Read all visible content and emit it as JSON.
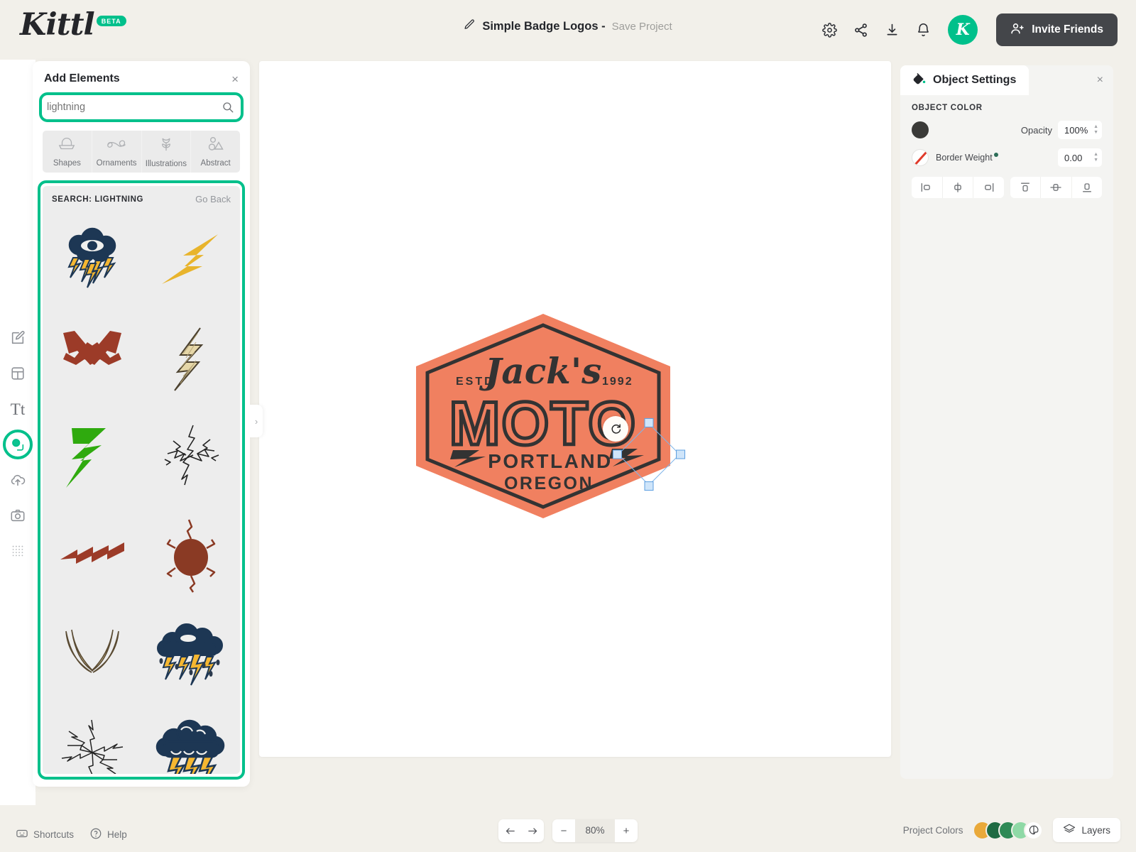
{
  "app": {
    "brand": "Kittl",
    "brand_badge": "BETA",
    "project_name": "Simple Badge Logos -",
    "save_project_label": "Save Project",
    "accent_color": "#00c08b",
    "avatar_initial": "K"
  },
  "header": {
    "icons": [
      {
        "name": "settings-gear-icon"
      },
      {
        "name": "share-icon"
      },
      {
        "name": "download-icon"
      },
      {
        "name": "notifications-bell-icon"
      }
    ],
    "invite_label": "Invite Friends"
  },
  "left_rail": {
    "items": [
      {
        "name": "design-edit-tool",
        "label": "Design"
      },
      {
        "name": "templates-tool",
        "label": "Templates"
      },
      {
        "name": "text-tool",
        "label": "Tt"
      },
      {
        "name": "elements-tool",
        "label": "Elements",
        "active": true
      },
      {
        "name": "uploads-tool",
        "label": "Uploads"
      },
      {
        "name": "photos-tool",
        "label": "Photos"
      },
      {
        "name": "mockups-tool",
        "label": "Mockups"
      }
    ]
  },
  "elements_panel": {
    "title": "Add Elements",
    "close_label": "×",
    "search": {
      "value": "lightning",
      "placeholder": "lightning",
      "icon": "search-icon",
      "highlighted": true
    },
    "categories": [
      {
        "label": "Shapes",
        "icon": "banner-shape-icon"
      },
      {
        "label": "Ornaments",
        "icon": "flourish-icon"
      },
      {
        "label": "Illustrations",
        "icon": "tulip-icon"
      },
      {
        "label": "Abstract",
        "icon": "abstract-circles-icon"
      }
    ],
    "results": {
      "title": "SEARCH: LIGHTNING",
      "go_back_label": "Go Back",
      "highlighted": true,
      "items": [
        {
          "name": "cloud-eye-lightning-element",
          "style": "cloud-eye"
        },
        {
          "name": "yellow-bolt-element",
          "style": "yellow-bolt"
        },
        {
          "name": "crossed-bolts-element",
          "style": "crossed-bolts"
        },
        {
          "name": "hatched-bolt-element",
          "style": "hatched-bolt"
        },
        {
          "name": "green-bolt-element",
          "style": "green-bolt"
        },
        {
          "name": "sketch-lightning-element",
          "style": "sketch-lightning"
        },
        {
          "name": "small-red-bolt-element",
          "style": "small-red-bolt"
        },
        {
          "name": "cracked-blob-element",
          "style": "cracked-blob"
        },
        {
          "name": "curved-bolt-pair-element",
          "style": "curved-pair"
        },
        {
          "name": "storm-cloud-rain-element",
          "style": "storm-rain"
        },
        {
          "name": "radial-lightning-element",
          "style": "radial-lightning"
        },
        {
          "name": "storm-cloud-bolts-element",
          "style": "storm-bolts"
        }
      ]
    },
    "collapse_icon": "›"
  },
  "canvas": {
    "badge": {
      "script_name": "Jack's",
      "estd_label": "ESTD",
      "year": "1992",
      "main_word": "MOTO",
      "city": "PORTLAND",
      "state": "OREGON",
      "fill_color": "#f08060",
      "ink_color": "#333333"
    },
    "selection": {
      "rotate_icon": "rotate-handle-icon",
      "handles": 4
    }
  },
  "object_settings": {
    "title": "Object Settings",
    "icon": "paint-bucket-icon",
    "close_label": "×",
    "section_label": "OBJECT COLOR",
    "object_color": "#3a3a38",
    "opacity_label": "Opacity",
    "opacity_value": "100%",
    "border_weight_label": "Border Weight",
    "border_weight_value": "0.00",
    "align_buttons": [
      {
        "name": "align-left-button",
        "icon": "align-left-icon"
      },
      {
        "name": "align-center-horizontal-button",
        "icon": "align-center-h-icon"
      },
      {
        "name": "align-right-button",
        "icon": "align-right-icon"
      },
      {
        "name": "align-top-button",
        "icon": "align-top-icon"
      },
      {
        "name": "align-middle-vertical-button",
        "icon": "align-middle-v-icon"
      },
      {
        "name": "align-bottom-button",
        "icon": "align-bottom-icon"
      }
    ]
  },
  "bottom_bar": {
    "shortcuts_label": "Shortcuts",
    "help_label": "Help",
    "undo_icon": "undo-arrow-icon",
    "redo_icon": "redo-arrow-icon",
    "zoom_out_label": "−",
    "zoom_value": "80%",
    "zoom_in_label": "+",
    "project_colors_label": "Project Colors",
    "project_colors": [
      "#e9a93a",
      "#1f6b43",
      "#2f8a56",
      "#8fd9a6"
    ],
    "palette_icon": "palette-icon",
    "layers_label": "Layers",
    "layers_icon": "layers-icon"
  }
}
